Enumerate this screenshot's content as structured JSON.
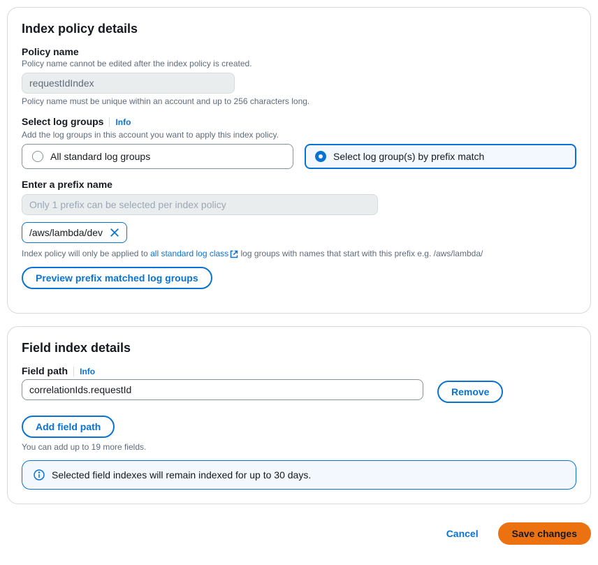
{
  "panel1": {
    "title": "Index policy details",
    "policyName": {
      "label": "Policy name",
      "sublabel": "Policy name cannot be edited after the index policy is created.",
      "value": "requestIdIndex",
      "hint": "Policy name must be unique within an account and up to 256 characters long."
    },
    "selectLogGroups": {
      "label": "Select log groups",
      "infoLabel": "Info",
      "sublabel": "Add the log groups in this account you want to apply this index policy.",
      "optionAll": "All standard log groups",
      "optionPrefix": "Select log group(s) by prefix match"
    },
    "prefix": {
      "label": "Enter a prefix name",
      "placeholder": "Only 1 prefix can be selected per index policy",
      "tokenValue": "/aws/lambda/dev",
      "noteBefore": "Index policy will only be applied to ",
      "noteLink": "all standard log class",
      "noteAfter": " log groups with names that start with this prefix e.g. /aws/lambda/",
      "previewButton": "Preview prefix matched log groups"
    }
  },
  "panel2": {
    "title": "Field index details",
    "fieldPath": {
      "label": "Field path",
      "infoLabel": "Info",
      "value": "correlationIds.requestId",
      "removeLabel": "Remove"
    },
    "addButton": "Add field path",
    "hint": "You can add up to 19 more fields.",
    "infoBox": "Selected field indexes will remain indexed for up to 30 days."
  },
  "footer": {
    "cancel": "Cancel",
    "save": "Save changes"
  }
}
